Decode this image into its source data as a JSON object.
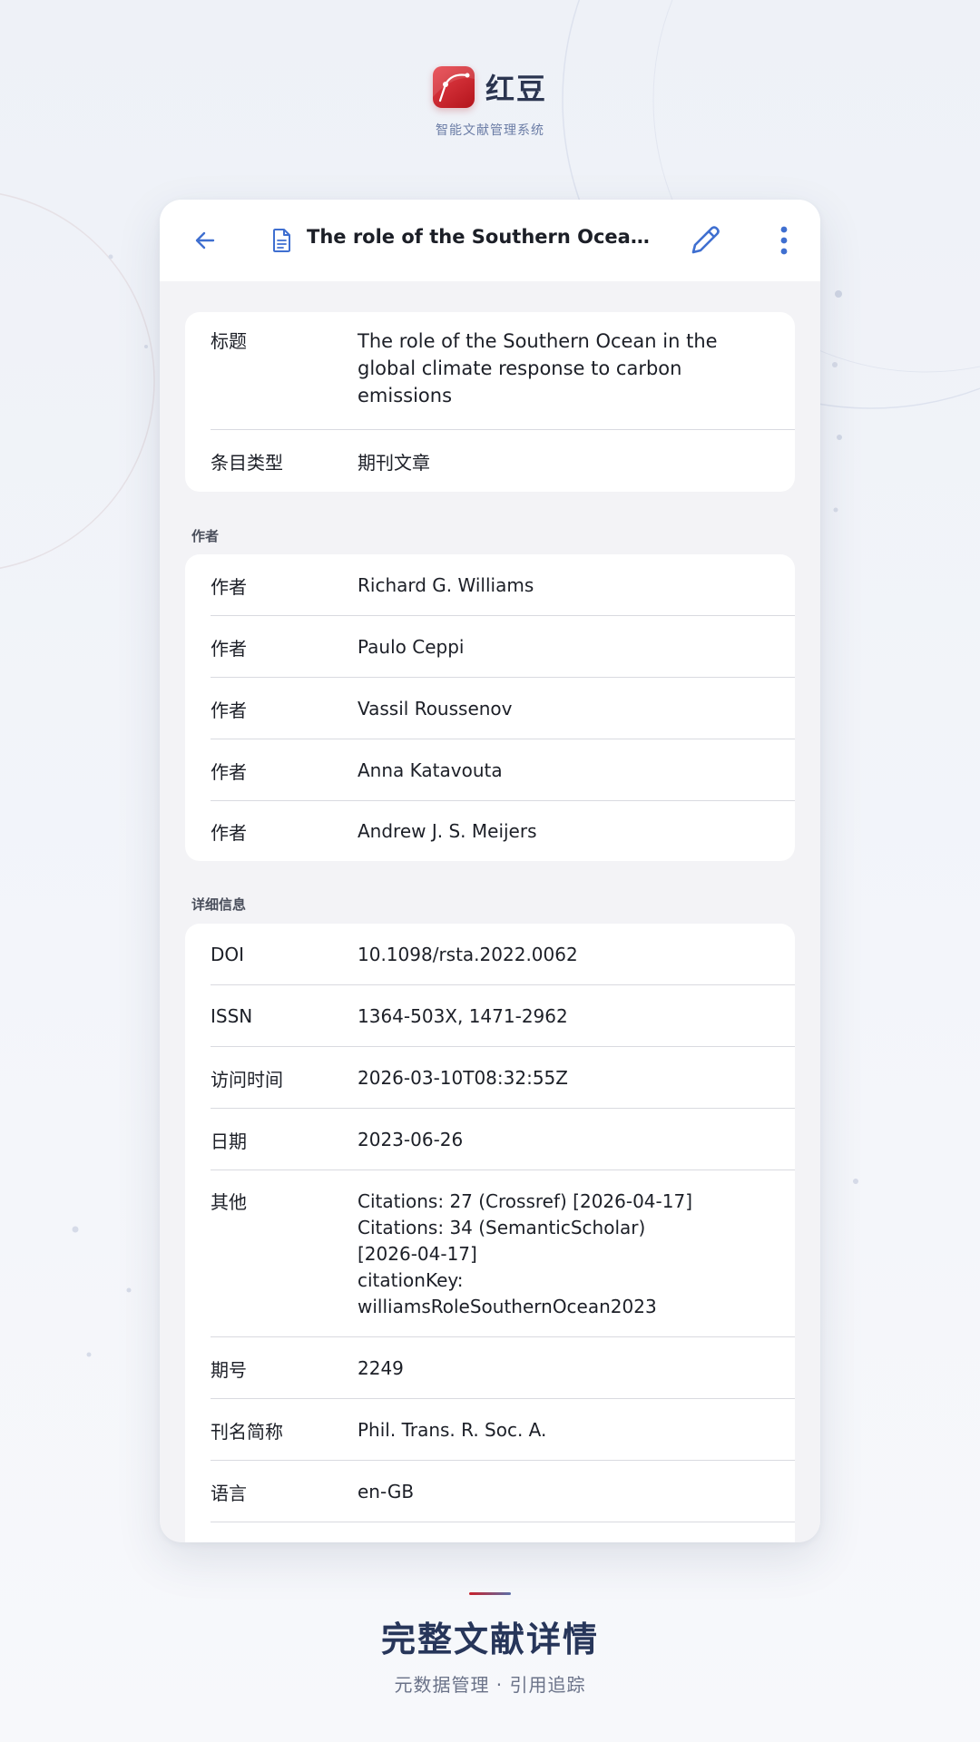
{
  "brand": {
    "name": "红豆",
    "subtitle": "智能文献管理系统"
  },
  "appbar": {
    "title": "The role of the Southern Ocean in the global climate response to carbon emissions"
  },
  "info": {
    "rows": [
      {
        "label": "标题",
        "value": "The role of the Southern Ocean in the global climate response to carbon emissions"
      },
      {
        "label": "条目类型",
        "value": "期刊文章"
      }
    ]
  },
  "authors": {
    "section_label": "作者",
    "rows": [
      {
        "label": "作者",
        "value": "Richard G. Williams"
      },
      {
        "label": "作者",
        "value": "Paulo Ceppi"
      },
      {
        "label": "作者",
        "value": "Vassil Roussenov"
      },
      {
        "label": "作者",
        "value": "Anna Katavouta"
      },
      {
        "label": "作者",
        "value": "Andrew J. S. Meijers"
      }
    ]
  },
  "details": {
    "section_label": "详细信息",
    "rows": [
      {
        "label": "DOI",
        "value": "10.1098/rsta.2022.0062"
      },
      {
        "label": "ISSN",
        "value": "1364-503X, 1471-2962"
      },
      {
        "label": "访问时间",
        "value": "2026-03-10T08:32:55Z"
      },
      {
        "label": "日期",
        "value": "2023-06-26"
      },
      {
        "label": "其他",
        "value": "Citations: 27 (Crossref) [2026-04-17]\nCitations: 34 (SemanticScholar)\n[2026-04-17]\ncitationKey:\nwilliamsRoleSouthernOcean2023"
      },
      {
        "label": "期号",
        "value": "2249"
      },
      {
        "label": "刊名简称",
        "value": "Phil. Trans. R. Soc. A."
      },
      {
        "label": "语言",
        "value": "en-GB"
      }
    ]
  },
  "caption": {
    "headline": "完整文献详情",
    "subtitle": "元数据管理 · 引用追踪"
  },
  "icons": {
    "back": "arrow-left-icon",
    "document": "document-icon",
    "edit": "pencil-icon",
    "more": "more-vertical-icon"
  },
  "colors": {
    "accent_blue": "#3f6fd0",
    "brand_red": "#c8202a",
    "headline": "#27365a"
  }
}
